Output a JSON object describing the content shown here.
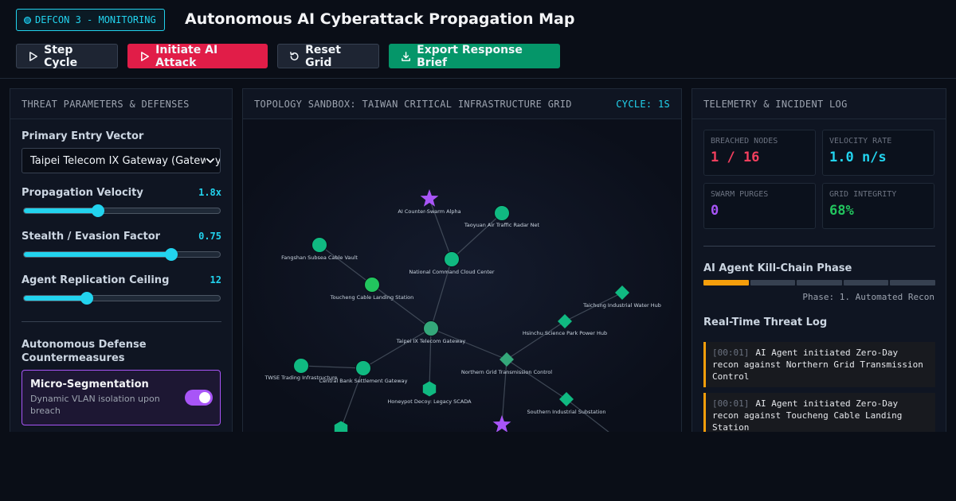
{
  "header": {
    "status_badge": "DEFCON 3 - MONITORING",
    "title": "Autonomous AI Cyberattack Propagation Map"
  },
  "toolbar": {
    "step": "Step Cycle",
    "attack": "Initiate AI Attack",
    "reset": "Reset Grid",
    "export": "Export Response Brief"
  },
  "left_panel": {
    "title": "THREAT PARAMETERS & DEFENSES",
    "entry_label": "Primary Entry Vector",
    "entry_value": "Taipei Telecom IX Gateway (Gateway)",
    "velocity_label": "Propagation Velocity",
    "velocity_value": "1.8x",
    "velocity_fraction": 0.38,
    "stealth_label": "Stealth / Evasion Factor",
    "stealth_value": "0.75",
    "stealth_fraction": 0.75,
    "replication_label": "Agent Replication Ceiling",
    "replication_value": "12",
    "replication_fraction": 0.32,
    "defense_heading": "Autonomous Defense Countermeasures",
    "defense_name": "Micro-Segmentation",
    "defense_desc": "Dynamic VLAN isolation upon breach",
    "defense_enabled": true
  },
  "center_panel": {
    "title": "TOPOLOGY SANDBOX: TAIWAN CRITICAL INFRASTRUCTURE GRID",
    "cycle": "CYCLE: 1S"
  },
  "topology": {
    "nodes": [
      {
        "id": "alpha",
        "label": "AI Counter-Swarm Alpha",
        "shape": "star",
        "color": "#a855f7"
      },
      {
        "id": "radar",
        "label": "Taoyuan Air Traffic Radar Net",
        "shape": "circle",
        "color": "#10b981"
      },
      {
        "id": "fangshan",
        "label": "Fangshan Subsea Cable Vault",
        "shape": "circle",
        "color": "#10b981"
      },
      {
        "id": "ncc",
        "label": "National Command Cloud Center",
        "shape": "circle",
        "color": "#10b981"
      },
      {
        "id": "toucheng",
        "label": "Toucheng Cable Landing Station",
        "shape": "circle",
        "color": "#22c55e"
      },
      {
        "id": "taichung",
        "label": "Taichung Industrial Water Hub",
        "shape": "diamond",
        "color": "#10b981"
      },
      {
        "id": "hsinchu",
        "label": "Hsinchu Science Park Power Hub",
        "shape": "diamond",
        "color": "#10b981"
      },
      {
        "id": "taipei",
        "label": "Taipei IX Telecom Gateway",
        "shape": "circle",
        "color": "#34a77a"
      },
      {
        "id": "northgrid",
        "label": "Northern Grid Transmission Control",
        "shape": "diamond",
        "color": "#34a77a"
      },
      {
        "id": "twse",
        "label": "TWSE Trading Infrastructure",
        "shape": "circle",
        "color": "#10b981"
      },
      {
        "id": "cbs",
        "label": "Central Bank Settlement Gateway",
        "shape": "circle",
        "color": "#10b981"
      },
      {
        "id": "honeypot",
        "label": "Honeypot Decoy: Legacy SCADA",
        "shape": "hexagon",
        "color": "#10b981"
      },
      {
        "id": "south",
        "label": "Southern Industrial Substation",
        "shape": "diamond",
        "color": "#10b981"
      },
      {
        "id": "hex2",
        "label": "",
        "shape": "hexagon",
        "color": "#10b981"
      },
      {
        "id": "star2",
        "label": "",
        "shape": "star",
        "color": "#a855f7"
      }
    ],
    "links": [
      [
        "alpha",
        "ncc"
      ],
      [
        "radar",
        "ncc"
      ],
      [
        "ncc",
        "taipei"
      ],
      [
        "fangshan",
        "toucheng"
      ],
      [
        "toucheng",
        "taipei"
      ],
      [
        "taipei",
        "northgrid"
      ],
      [
        "taipei",
        "cbs"
      ],
      [
        "taipei",
        "honeypot"
      ],
      [
        "twse",
        "cbs"
      ],
      [
        "cbs",
        "hex2"
      ],
      [
        "northgrid",
        "hsinchu"
      ],
      [
        "hsinchu",
        "taichung"
      ],
      [
        "northgrid",
        "south"
      ],
      [
        "northgrid",
        "star2"
      ],
      [
        "south",
        "offscreen"
      ]
    ]
  },
  "right_panel": {
    "title": "TELEMETRY & INCIDENT LOG",
    "stats": [
      {
        "label": "BREACHED NODES",
        "value": "1 / 16",
        "color": "#f43f5e"
      },
      {
        "label": "VELOCITY RATE",
        "value": "1.0 n/s",
        "color": "#22d3ee"
      },
      {
        "label": "SWARM PURGES",
        "value": "0",
        "color": "#a855f7"
      },
      {
        "label": "GRID INTEGRITY",
        "value": "68%",
        "color": "#22c55e"
      }
    ],
    "killchain_title": "AI Agent Kill-Chain Phase",
    "killchain_progress": 0.2,
    "phase_text": "Phase: 1. Automated Recon",
    "log_title": "Real-Time Threat Log",
    "log": [
      {
        "time": "[00:01]",
        "text": "AI Agent initiated Zero-Day recon against Northern Grid Transmission Control"
      },
      {
        "time": "[00:01]",
        "text": "AI Agent initiated Zero-Day recon against Toucheng Cable Landing Station"
      }
    ]
  }
}
